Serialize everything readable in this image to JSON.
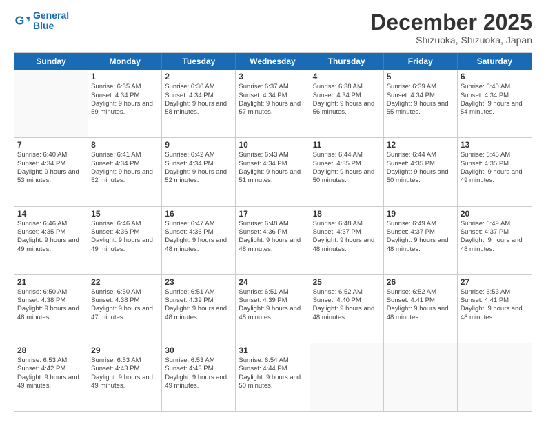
{
  "logo": {
    "line1": "General",
    "line2": "Blue"
  },
  "title": "December 2025",
  "subtitle": "Shizuoka, Shizuoka, Japan",
  "header_days": [
    "Sunday",
    "Monday",
    "Tuesday",
    "Wednesday",
    "Thursday",
    "Friday",
    "Saturday"
  ],
  "weeks": [
    [
      {
        "day": "",
        "sunrise": "",
        "sunset": "",
        "daylight": ""
      },
      {
        "day": "1",
        "sunrise": "Sunrise: 6:35 AM",
        "sunset": "Sunset: 4:34 PM",
        "daylight": "Daylight: 9 hours and 59 minutes."
      },
      {
        "day": "2",
        "sunrise": "Sunrise: 6:36 AM",
        "sunset": "Sunset: 4:34 PM",
        "daylight": "Daylight: 9 hours and 58 minutes."
      },
      {
        "day": "3",
        "sunrise": "Sunrise: 6:37 AM",
        "sunset": "Sunset: 4:34 PM",
        "daylight": "Daylight: 9 hours and 57 minutes."
      },
      {
        "day": "4",
        "sunrise": "Sunrise: 6:38 AM",
        "sunset": "Sunset: 4:34 PM",
        "daylight": "Daylight: 9 hours and 56 minutes."
      },
      {
        "day": "5",
        "sunrise": "Sunrise: 6:39 AM",
        "sunset": "Sunset: 4:34 PM",
        "daylight": "Daylight: 9 hours and 55 minutes."
      },
      {
        "day": "6",
        "sunrise": "Sunrise: 6:40 AM",
        "sunset": "Sunset: 4:34 PM",
        "daylight": "Daylight: 9 hours and 54 minutes."
      }
    ],
    [
      {
        "day": "7",
        "sunrise": "Sunrise: 6:40 AM",
        "sunset": "Sunset: 4:34 PM",
        "daylight": "Daylight: 9 hours and 53 minutes."
      },
      {
        "day": "8",
        "sunrise": "Sunrise: 6:41 AM",
        "sunset": "Sunset: 4:34 PM",
        "daylight": "Daylight: 9 hours and 52 minutes."
      },
      {
        "day": "9",
        "sunrise": "Sunrise: 6:42 AM",
        "sunset": "Sunset: 4:34 PM",
        "daylight": "Daylight: 9 hours and 52 minutes."
      },
      {
        "day": "10",
        "sunrise": "Sunrise: 6:43 AM",
        "sunset": "Sunset: 4:34 PM",
        "daylight": "Daylight: 9 hours and 51 minutes."
      },
      {
        "day": "11",
        "sunrise": "Sunrise: 6:44 AM",
        "sunset": "Sunset: 4:35 PM",
        "daylight": "Daylight: 9 hours and 50 minutes."
      },
      {
        "day": "12",
        "sunrise": "Sunrise: 6:44 AM",
        "sunset": "Sunset: 4:35 PM",
        "daylight": "Daylight: 9 hours and 50 minutes."
      },
      {
        "day": "13",
        "sunrise": "Sunrise: 6:45 AM",
        "sunset": "Sunset: 4:35 PM",
        "daylight": "Daylight: 9 hours and 49 minutes."
      }
    ],
    [
      {
        "day": "14",
        "sunrise": "Sunrise: 6:46 AM",
        "sunset": "Sunset: 4:35 PM",
        "daylight": "Daylight: 9 hours and 49 minutes."
      },
      {
        "day": "15",
        "sunrise": "Sunrise: 6:46 AM",
        "sunset": "Sunset: 4:36 PM",
        "daylight": "Daylight: 9 hours and 49 minutes."
      },
      {
        "day": "16",
        "sunrise": "Sunrise: 6:47 AM",
        "sunset": "Sunset: 4:36 PM",
        "daylight": "Daylight: 9 hours and 48 minutes."
      },
      {
        "day": "17",
        "sunrise": "Sunrise: 6:48 AM",
        "sunset": "Sunset: 4:36 PM",
        "daylight": "Daylight: 9 hours and 48 minutes."
      },
      {
        "day": "18",
        "sunrise": "Sunrise: 6:48 AM",
        "sunset": "Sunset: 4:37 PM",
        "daylight": "Daylight: 9 hours and 48 minutes."
      },
      {
        "day": "19",
        "sunrise": "Sunrise: 6:49 AM",
        "sunset": "Sunset: 4:37 PM",
        "daylight": "Daylight: 9 hours and 48 minutes."
      },
      {
        "day": "20",
        "sunrise": "Sunrise: 6:49 AM",
        "sunset": "Sunset: 4:37 PM",
        "daylight": "Daylight: 9 hours and 48 minutes."
      }
    ],
    [
      {
        "day": "21",
        "sunrise": "Sunrise: 6:50 AM",
        "sunset": "Sunset: 4:38 PM",
        "daylight": "Daylight: 9 hours and 48 minutes."
      },
      {
        "day": "22",
        "sunrise": "Sunrise: 6:50 AM",
        "sunset": "Sunset: 4:38 PM",
        "daylight": "Daylight: 9 hours and 47 minutes."
      },
      {
        "day": "23",
        "sunrise": "Sunrise: 6:51 AM",
        "sunset": "Sunset: 4:39 PM",
        "daylight": "Daylight: 9 hours and 48 minutes."
      },
      {
        "day": "24",
        "sunrise": "Sunrise: 6:51 AM",
        "sunset": "Sunset: 4:39 PM",
        "daylight": "Daylight: 9 hours and 48 minutes."
      },
      {
        "day": "25",
        "sunrise": "Sunrise: 6:52 AM",
        "sunset": "Sunset: 4:40 PM",
        "daylight": "Daylight: 9 hours and 48 minutes."
      },
      {
        "day": "26",
        "sunrise": "Sunrise: 6:52 AM",
        "sunset": "Sunset: 4:41 PM",
        "daylight": "Daylight: 9 hours and 48 minutes."
      },
      {
        "day": "27",
        "sunrise": "Sunrise: 6:53 AM",
        "sunset": "Sunset: 4:41 PM",
        "daylight": "Daylight: 9 hours and 48 minutes."
      }
    ],
    [
      {
        "day": "28",
        "sunrise": "Sunrise: 6:53 AM",
        "sunset": "Sunset: 4:42 PM",
        "daylight": "Daylight: 9 hours and 49 minutes."
      },
      {
        "day": "29",
        "sunrise": "Sunrise: 6:53 AM",
        "sunset": "Sunset: 4:43 PM",
        "daylight": "Daylight: 9 hours and 49 minutes."
      },
      {
        "day": "30",
        "sunrise": "Sunrise: 6:53 AM",
        "sunset": "Sunset: 4:43 PM",
        "daylight": "Daylight: 9 hours and 49 minutes."
      },
      {
        "day": "31",
        "sunrise": "Sunrise: 6:54 AM",
        "sunset": "Sunset: 4:44 PM",
        "daylight": "Daylight: 9 hours and 50 minutes."
      },
      {
        "day": "",
        "sunrise": "",
        "sunset": "",
        "daylight": ""
      },
      {
        "day": "",
        "sunrise": "",
        "sunset": "",
        "daylight": ""
      },
      {
        "day": "",
        "sunrise": "",
        "sunset": "",
        "daylight": ""
      }
    ]
  ]
}
